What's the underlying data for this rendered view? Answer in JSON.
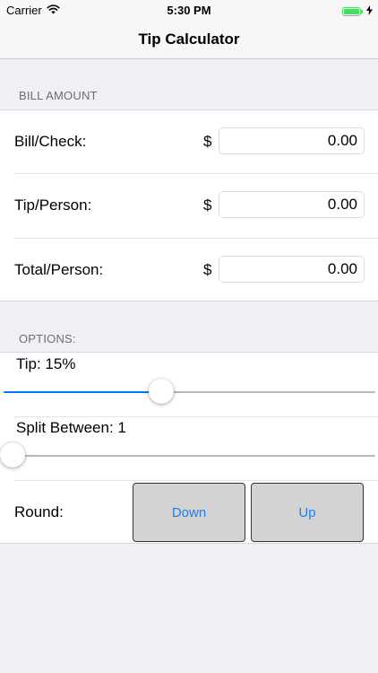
{
  "status_bar": {
    "carrier": "Carrier",
    "time": "5:30 PM",
    "icons": [
      "wifi-icon",
      "battery-icon",
      "charging-bolt-icon"
    ]
  },
  "nav": {
    "title": "Tip Calculator"
  },
  "bill_section": {
    "header": "BILL AMOUNT",
    "currency_symbol": "$",
    "rows": [
      {
        "label": "Bill/Check:",
        "value": "0.00"
      },
      {
        "label": "Tip/Person:",
        "value": "0.00"
      },
      {
        "label": "Total/Person:",
        "value": "0.00"
      }
    ]
  },
  "options_section": {
    "header": "OPTIONS:",
    "tip": {
      "label": "Tip: 15%",
      "slider_fraction": 0.42
    },
    "split": {
      "label": "Split Between: 1",
      "slider_fraction": 0.0
    },
    "round": {
      "label": "Round:",
      "down_label": "Down",
      "up_label": "Up"
    }
  },
  "colors": {
    "accent": "#007aff",
    "button_background": "#d3d3d3",
    "battery": "#4cd964",
    "page_background": "#efeff4"
  }
}
